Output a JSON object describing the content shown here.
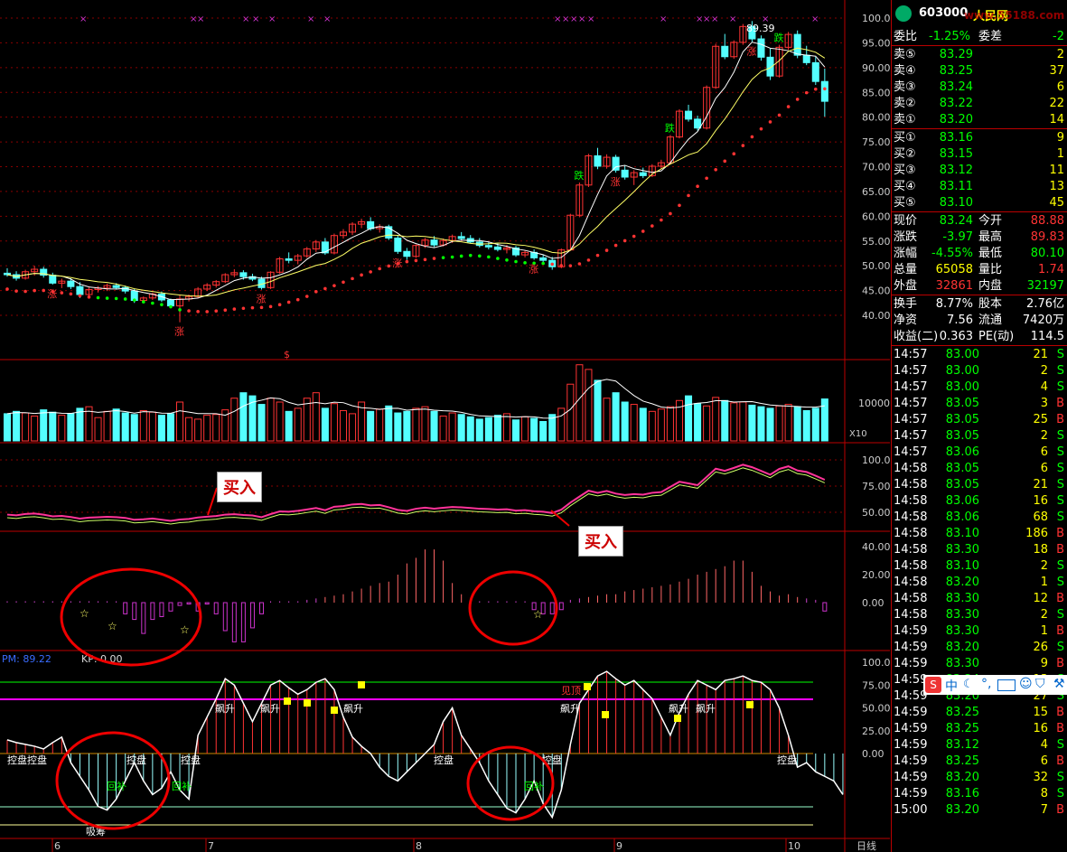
{
  "colors": {
    "up": "#ff3333",
    "down": "#54ffff",
    "green": "#00ff00",
    "yellow": "#ffff00",
    "magenta": "#ff00ff",
    "grid": "#880000",
    "axis": "#ff5555",
    "white": "#ffffff"
  },
  "header": {
    "code": "603000",
    "name": "人民网",
    "watermark": "www.55188.com"
  },
  "quote": {
    "weibi": {
      "label": "委比",
      "value": "-1.25%",
      "label2": "委差",
      "value2": "-2"
    },
    "sell": [
      {
        "label": "卖⑤",
        "price": "83.29",
        "vol": "2"
      },
      {
        "label": "卖④",
        "price": "83.25",
        "vol": "37"
      },
      {
        "label": "卖③",
        "price": "83.24",
        "vol": "6"
      },
      {
        "label": "卖②",
        "price": "83.22",
        "vol": "22"
      },
      {
        "label": "卖①",
        "price": "83.20",
        "vol": "14"
      }
    ],
    "buy": [
      {
        "label": "买①",
        "price": "83.16",
        "vol": "9"
      },
      {
        "label": "买②",
        "price": "83.15",
        "vol": "1"
      },
      {
        "label": "买③",
        "price": "83.12",
        "vol": "11"
      },
      {
        "label": "买④",
        "price": "83.11",
        "vol": "13"
      },
      {
        "label": "买⑤",
        "price": "83.10",
        "vol": "45"
      }
    ],
    "stats": [
      {
        "l1": "现价",
        "v1": "83.24",
        "l2": "今开",
        "v2": "88.88",
        "c1": "#00ff00",
        "c2": "#ff3333"
      },
      {
        "l1": "涨跌",
        "v1": "-3.97",
        "l2": "最高",
        "v2": "89.83",
        "c1": "#00ff00",
        "c2": "#ff3333"
      },
      {
        "l1": "涨幅",
        "v1": "-4.55%",
        "l2": "最低",
        "v2": "80.10",
        "c1": "#00ff00",
        "c2": "#00ff00"
      },
      {
        "l1": "总量",
        "v1": "65058",
        "l2": "量比",
        "v2": "1.74",
        "c1": "#ffff00",
        "c2": "#ff3333"
      },
      {
        "l1": "外盘",
        "v1": "32861",
        "l2": "内盘",
        "v2": "32197",
        "c1": "#ff3333",
        "c2": "#00ff00"
      }
    ],
    "info": [
      {
        "l1": "换手",
        "v1": "8.77%",
        "l2": "股本",
        "v2": "2.76亿"
      },
      {
        "l1": "净资",
        "v1": "7.56",
        "l2": "流通",
        "v2": "7420万"
      },
      {
        "l1": "收益(二)",
        "v1": "0.363",
        "l2": "PE(动)",
        "v2": "114.5"
      }
    ]
  },
  "ticks": [
    {
      "t": "14:57",
      "p": "83.00",
      "v": "21",
      "d": "S"
    },
    {
      "t": "14:57",
      "p": "83.00",
      "v": "2",
      "d": "S"
    },
    {
      "t": "14:57",
      "p": "83.00",
      "v": "4",
      "d": "S"
    },
    {
      "t": "14:57",
      "p": "83.05",
      "v": "3",
      "d": "B"
    },
    {
      "t": "14:57",
      "p": "83.05",
      "v": "25",
      "d": "B"
    },
    {
      "t": "14:57",
      "p": "83.05",
      "v": "2",
      "d": "S"
    },
    {
      "t": "14:57",
      "p": "83.06",
      "v": "6",
      "d": "S"
    },
    {
      "t": "14:58",
      "p": "83.05",
      "v": "6",
      "d": "S"
    },
    {
      "t": "14:58",
      "p": "83.05",
      "v": "21",
      "d": "S"
    },
    {
      "t": "14:58",
      "p": "83.06",
      "v": "16",
      "d": "S"
    },
    {
      "t": "14:58",
      "p": "83.06",
      "v": "68",
      "d": "S"
    },
    {
      "t": "14:58",
      "p": "83.10",
      "v": "186",
      "d": "B"
    },
    {
      "t": "14:58",
      "p": "83.30",
      "v": "18",
      "d": "B"
    },
    {
      "t": "14:58",
      "p": "83.10",
      "v": "2",
      "d": "S"
    },
    {
      "t": "14:58",
      "p": "83.20",
      "v": "1",
      "d": "S"
    },
    {
      "t": "14:58",
      "p": "83.30",
      "v": "12",
      "d": "B"
    },
    {
      "t": "14:58",
      "p": "83.30",
      "v": "2",
      "d": "S"
    },
    {
      "t": "14:59",
      "p": "83.30",
      "v": "1",
      "d": "B"
    },
    {
      "t": "14:59",
      "p": "83.20",
      "v": "26",
      "d": "S"
    },
    {
      "t": "14:59",
      "p": "83.30",
      "v": "9",
      "d": "B"
    },
    {
      "t": "14:59",
      "p": "83.24",
      "v": "13",
      "d": "S"
    },
    {
      "t": "14:59",
      "p": "83.20",
      "v": "27",
      "d": "S"
    },
    {
      "t": "14:59",
      "p": "83.25",
      "v": "15",
      "d": "B"
    },
    {
      "t": "14:59",
      "p": "83.25",
      "v": "16",
      "d": "B"
    },
    {
      "t": "14:59",
      "p": "83.12",
      "v": "4",
      "d": "S"
    },
    {
      "t": "14:59",
      "p": "83.25",
      "v": "6",
      "d": "B"
    },
    {
      "t": "14:59",
      "p": "83.20",
      "v": "32",
      "d": "S"
    },
    {
      "t": "14:59",
      "p": "83.16",
      "v": "8",
      "d": "S"
    },
    {
      "t": "15:00",
      "p": "83.20",
      "v": "7",
      "d": "B"
    }
  ],
  "axes": {
    "price_ticks": [
      "100.0",
      "95.00",
      "90.00",
      "85.00",
      "80.00",
      "75.00",
      "70.00",
      "65.00",
      "60.00",
      "55.00",
      "50.00",
      "45.00",
      "40.00"
    ],
    "vol_tick": "10000",
    "vol_unit": "X10",
    "ind1_ticks": [
      "100.0",
      "75.00",
      "50.00"
    ],
    "ind2_ticks": [
      "40.00",
      "20.00",
      "0.00"
    ],
    "ind3_ticks": [
      "100.0",
      "75.00",
      "50.00",
      "25.00",
      "0.00"
    ],
    "months": [
      "6",
      "7",
      "8",
      "9",
      "10"
    ],
    "period": "日线"
  },
  "labels": {
    "high": "89.39",
    "buy1": "买入",
    "buy2": "买入",
    "pm": "PM: 89.22",
    "kp": "KP: 0.00",
    "zhang": "涨",
    "die": "跌",
    "dollar": "$",
    "star": "☆",
    "kongpan": "控盘",
    "huibu": "回补",
    "piaosheng": "飙升",
    "xichou": "吸筹",
    "huaguan": "见顶",
    "chuhuo": "出货"
  },
  "toolbar_icons": [
    "S",
    "中",
    "moon-icon",
    "comma-icon",
    "keyboard-icon",
    "user-icon",
    "shirt-icon",
    "wrench-icon"
  ],
  "chart_data": {
    "type": "candlestick",
    "x_ticks": [
      "6",
      "7",
      "8",
      "9",
      "10"
    ],
    "ylim": [
      37,
      101
    ],
    "candles": [
      [
        48.5,
        49.5,
        47.8,
        48.2
      ],
      [
        48.2,
        48.9,
        47,
        47.5
      ],
      [
        47.5,
        49.2,
        47.2,
        48.8
      ],
      [
        48.8,
        50,
        48,
        49.3
      ],
      [
        49.3,
        49.8,
        47.6,
        48.1
      ],
      [
        48.1,
        48.6,
        46.2,
        46.5
      ],
      [
        46.5,
        47.4,
        45.5,
        46.9
      ],
      [
        46.9,
        47.5,
        45.3,
        45.8
      ],
      [
        45.8,
        46.7,
        43.5,
        44.2
      ],
      [
        44.2,
        45.6,
        43.8,
        45.2
      ],
      [
        45.2,
        45.9,
        44.6,
        45.5
      ],
      [
        45.5,
        46.4,
        44.9,
        46
      ],
      [
        46,
        46.5,
        45.2,
        45.6
      ],
      [
        45.6,
        46,
        44.4,
        44.9
      ],
      [
        44.9,
        45.3,
        42.5,
        43
      ],
      [
        43,
        43.8,
        42.6,
        43.5
      ],
      [
        43.5,
        44.6,
        43.1,
        44.3
      ],
      [
        44.3,
        44.8,
        42.7,
        43.1
      ],
      [
        43.1,
        43.4,
        41.5,
        41.9
      ],
      [
        41.9,
        44,
        38.6,
        43.3
      ],
      [
        43.3,
        44.2,
        42.8,
        43.8
      ],
      [
        43.8,
        45.7,
        43.4,
        45.3
      ],
      [
        45.3,
        46.5,
        44.9,
        46.1
      ],
      [
        46.1,
        47.1,
        45.6,
        46.8
      ],
      [
        46.8,
        48.5,
        46.5,
        48.2
      ],
      [
        48.2,
        49.3,
        47.7,
        48.6
      ],
      [
        48.6,
        49.1,
        47.2,
        47.8
      ],
      [
        47.8,
        48.4,
        46.9,
        47.3
      ],
      [
        47.3,
        47.8,
        45.2,
        45.6
      ],
      [
        45.6,
        48.9,
        45.3,
        48.7
      ],
      [
        48.7,
        51.8,
        48.4,
        51.4
      ],
      [
        51.4,
        52.7,
        50.5,
        51.1
      ],
      [
        51.1,
        52.4,
        50.3,
        52
      ],
      [
        52,
        53.8,
        51.6,
        53.4
      ],
      [
        53.4,
        55.2,
        52.8,
        54.8
      ],
      [
        54.8,
        55.6,
        52.2,
        52.6
      ],
      [
        52.6,
        56.5,
        52.3,
        56.1
      ],
      [
        56.1,
        57.4,
        55.5,
        56.8
      ],
      [
        56.8,
        58.8,
        56.2,
        58.4
      ],
      [
        58.4,
        59.5,
        57.6,
        58.9
      ],
      [
        58.9,
        59.8,
        57.1,
        57.5
      ],
      [
        57.5,
        58.4,
        56.7,
        57.9
      ],
      [
        57.9,
        58.3,
        55.2,
        55.6
      ],
      [
        55.6,
        56.2,
        52.4,
        52.9
      ],
      [
        52.9,
        53.6,
        51.2,
        51.9
      ],
      [
        51.9,
        54.3,
        51.6,
        54.1
      ],
      [
        54.1,
        55.6,
        53.6,
        55.2
      ],
      [
        55.2,
        56,
        53.8,
        54.2
      ],
      [
        54.2,
        55.5,
        53.9,
        55.1
      ],
      [
        55.1,
        56.3,
        54.6,
        55.9
      ],
      [
        55.9,
        56.8,
        55.1,
        55.5
      ],
      [
        55.5,
        56.2,
        54.5,
        54.8
      ],
      [
        54.8,
        55.6,
        53.7,
        54.1
      ],
      [
        54.1,
        54.9,
        53.3,
        53.8
      ],
      [
        53.8,
        54.6,
        52.9,
        53.3
      ],
      [
        53.3,
        54.2,
        52.5,
        53.6
      ],
      [
        53.6,
        54,
        51.8,
        52.2
      ],
      [
        52.2,
        53.1,
        51.7,
        52.7
      ],
      [
        52.7,
        53.3,
        51.2,
        51.6
      ],
      [
        51.6,
        52.3,
        50.6,
        51.1
      ],
      [
        51.1,
        51.8,
        49.2,
        49.8
      ],
      [
        49.8,
        53.5,
        49.5,
        53.2
      ],
      [
        53.2,
        60.5,
        53,
        60.2
      ],
      [
        60.2,
        66.8,
        59.8,
        66.3
      ],
      [
        66.3,
        72.6,
        65.9,
        72.2
      ],
      [
        72.2,
        73.8,
        69.5,
        70.1
      ],
      [
        70.1,
        72.5,
        69.6,
        71.9
      ],
      [
        71.9,
        72.4,
        68.8,
        69.3
      ],
      [
        69.3,
        70.2,
        67.4,
        67.9
      ],
      [
        67.9,
        69.3,
        66.3,
        68.8
      ],
      [
        68.8,
        69.8,
        67.7,
        68.2
      ],
      [
        68.2,
        70.5,
        67.9,
        70.1
      ],
      [
        70.1,
        71.4,
        69.6,
        70.8
      ],
      [
        70.8,
        76.4,
        70.5,
        76
      ],
      [
        76,
        81.6,
        75.7,
        81.2
      ],
      [
        81.2,
        82.5,
        79.1,
        79.6
      ],
      [
        79.6,
        80.3,
        77.3,
        77.8
      ],
      [
        77.8,
        86.4,
        77.5,
        86
      ],
      [
        86,
        94.8,
        85.7,
        94.3
      ],
      [
        94.3,
        96.8,
        91.7,
        92.2
      ],
      [
        92.2,
        95.5,
        91.8,
        95.1
      ],
      [
        95.1,
        98.8,
        94.6,
        98.3
      ],
      [
        98.3,
        99.4,
        95.2,
        95.8
      ],
      [
        95.8,
        96.5,
        91.4,
        92.1
      ],
      [
        92.1,
        93.8,
        87.5,
        88.3
      ],
      [
        88.3,
        94.6,
        88,
        94.1
      ],
      [
        94.1,
        97.2,
        93.6,
        96.7
      ],
      [
        96.7,
        97.5,
        91.9,
        92.5
      ],
      [
        92.5,
        94.4,
        90.5,
        91
      ],
      [
        91,
        92.2,
        86.5,
        87.2
      ],
      [
        87.2,
        89.8,
        80.1,
        83.2
      ]
    ],
    "volume": [
      0.35,
      0.38,
      0.36,
      0.32,
      0.4,
      0.37,
      0.33,
      0.35,
      0.42,
      0.44,
      0.3,
      0.38,
      0.41,
      0.36,
      0.34,
      0.39,
      0.37,
      0.33,
      0.35,
      0.5,
      0.3,
      0.28,
      0.33,
      0.34,
      0.4,
      0.55,
      0.62,
      0.58,
      0.47,
      0.55,
      0.5,
      0.38,
      0.42,
      0.55,
      0.62,
      0.42,
      0.48,
      0.39,
      0.35,
      0.5,
      0.38,
      0.41,
      0.45,
      0.36,
      0.38,
      0.42,
      0.44,
      0.38,
      0.32,
      0.36,
      0.34,
      0.31,
      0.28,
      0.3,
      0.33,
      0.35,
      0.27,
      0.31,
      0.29,
      0.25,
      0.34,
      0.42,
      0.73,
      0.98,
      0.92,
      0.78,
      0.55,
      0.62,
      0.5,
      0.47,
      0.42,
      0.38,
      0.41,
      0.44,
      0.52,
      0.58,
      0.48,
      0.45,
      0.56,
      0.52,
      0.49,
      0.5,
      0.46,
      0.44,
      0.42,
      0.45,
      0.47,
      0.44,
      0.39,
      0.42,
      0.54
    ],
    "ind2": [
      1,
      1,
      1,
      1,
      1,
      1,
      1,
      1,
      1,
      1,
      1,
      1,
      1,
      -8,
      -12,
      -22,
      -12,
      -10,
      -6,
      -2,
      -1,
      -6,
      -1,
      -8,
      -20,
      -28,
      -28,
      -18,
      -8,
      1,
      1,
      1,
      1,
      2,
      3,
      4,
      5,
      6,
      8,
      10,
      12,
      14,
      15,
      20,
      28,
      32,
      38,
      38,
      30,
      14,
      6,
      2,
      1,
      1,
      1,
      1,
      1,
      1,
      -5,
      -8,
      -8,
      -5,
      2,
      3,
      4,
      5,
      6,
      6,
      8,
      9,
      10,
      11,
      12,
      13,
      15,
      17,
      20,
      22,
      24,
      26,
      30,
      30,
      22,
      12,
      8,
      5,
      6,
      4,
      3,
      2,
      -6
    ],
    "ind3": [
      15,
      12,
      10,
      8,
      5,
      12,
      18,
      -10,
      -25,
      -40,
      -58,
      -62,
      -50,
      -30,
      -10,
      -30,
      -45,
      -38,
      -20,
      -40,
      -50,
      20,
      40,
      60,
      82,
      75,
      55,
      35,
      55,
      75,
      80,
      72,
      65,
      70,
      78,
      82,
      70,
      40,
      18,
      8,
      0,
      -15,
      -25,
      -30,
      -20,
      -10,
      0,
      10,
      35,
      50,
      20,
      5,
      -10,
      -30,
      -45,
      -60,
      -65,
      -50,
      -30,
      -55,
      -70,
      -40,
      10,
      55,
      70,
      85,
      90,
      82,
      75,
      80,
      70,
      60,
      40,
      20,
      45,
      65,
      80,
      75,
      70,
      80,
      82,
      85,
      80,
      78,
      70,
      50,
      20,
      -15,
      -10,
      -20,
      -25,
      -30,
      -45
    ]
  }
}
